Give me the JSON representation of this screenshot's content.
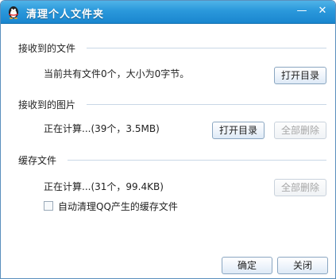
{
  "window": {
    "title": "清理个人文件夹",
    "minimize_glyph": "—",
    "close_glyph": "✕"
  },
  "sections": {
    "received_files": {
      "title": "接收到的文件",
      "info": "当前共有文件0个，大小为0字节。",
      "open_dir": "打开目录"
    },
    "received_images": {
      "title": "接收到的图片",
      "info": "正在计算...(39个，3.5MB)",
      "open_dir": "打开目录",
      "delete_all": "全部删除"
    },
    "cache_files": {
      "title": "缓存文件",
      "info": "正在计算...(31个，99.4KB)",
      "delete_all": "全部删除",
      "auto_clean_label": "自动清理QQ产生的缓存文件",
      "auto_clean_checked": false
    }
  },
  "footer": {
    "ok": "确定",
    "close": "关闭"
  },
  "colors": {
    "titlebar": "#2a98db",
    "section_line": "#c9d7e6",
    "disabled_text": "#a6a6a6"
  },
  "icons": {
    "app": "qq-penguin-icon"
  }
}
